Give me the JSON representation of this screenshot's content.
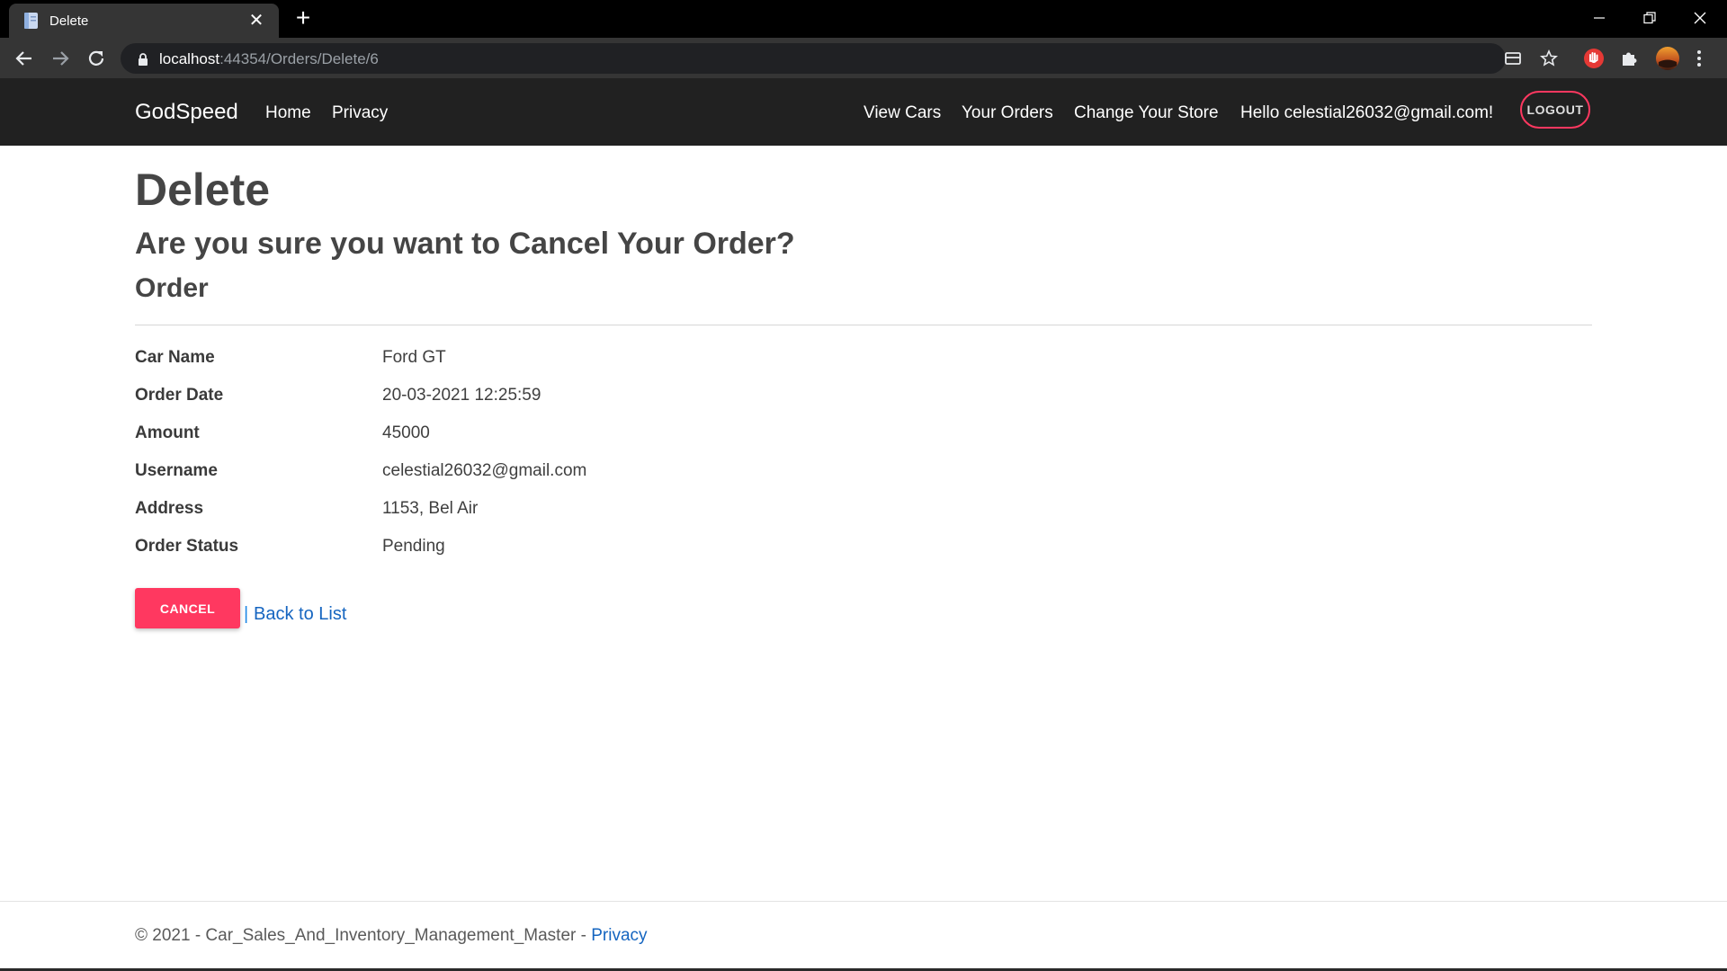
{
  "browser": {
    "tab_title": "Delete",
    "tab_close": "✕",
    "new_tab": "+",
    "url_host": "localhost",
    "url_rest": ":44354/Orders/Delete/6"
  },
  "navbar": {
    "brand": "GodSpeed",
    "left_links": [
      "Home",
      "Privacy"
    ],
    "right_links": [
      "View Cars",
      "Your Orders",
      "Change Your Store"
    ],
    "greeting": "Hello celestial26032@gmail.com!",
    "logout_label": "LOGOUT"
  },
  "page": {
    "title": "Delete",
    "question": "Are you sure you want to Cancel Your Order?",
    "section": "Order"
  },
  "order_details": [
    {
      "label": "Car Name",
      "value": "Ford GT"
    },
    {
      "label": "Order Date",
      "value": "20-03-2021 12:25:59"
    },
    {
      "label": "Amount",
      "value": "45000"
    },
    {
      "label": "Username",
      "value": "celestial26032@gmail.com"
    },
    {
      "label": "Address",
      "value": "1153, Bel Air"
    },
    {
      "label": "Order Status",
      "value": "Pending"
    }
  ],
  "actions": {
    "cancel_label": "CANCEL",
    "separator": "|",
    "back_label": "Back to List"
  },
  "footer": {
    "text": "© 2021 - Car_Sales_And_Inventory_Management_Master - ",
    "privacy_label": "Privacy"
  },
  "colors": {
    "accent": "#ff3860",
    "navbar_bg": "#212121",
    "link": "#1565c0"
  }
}
